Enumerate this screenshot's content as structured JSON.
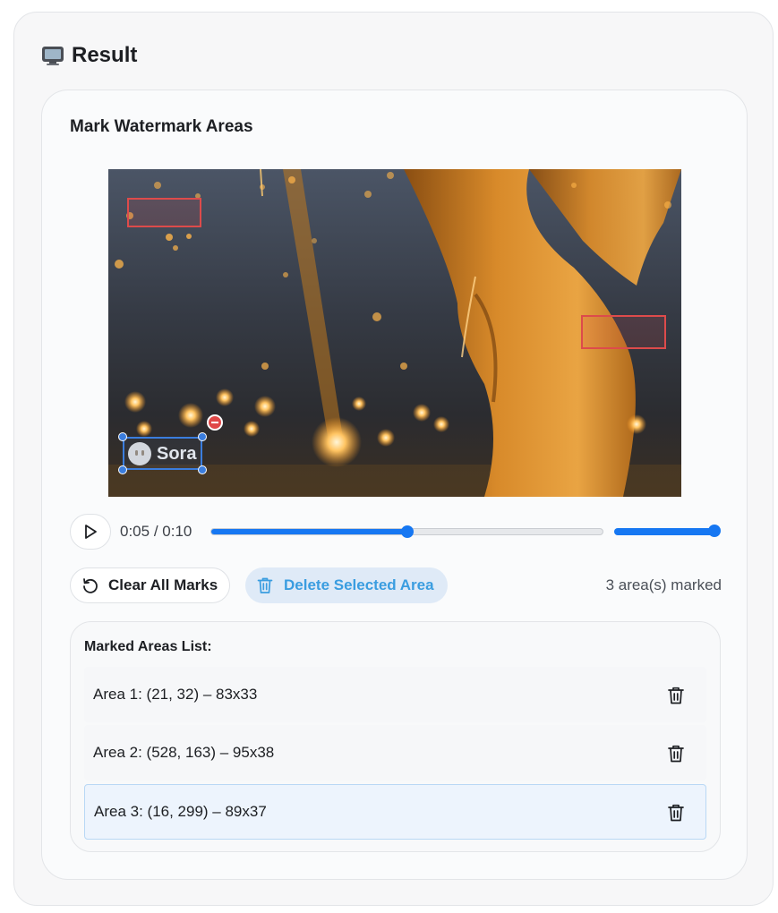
{
  "result": {
    "title": "Result",
    "icon": "tv-icon"
  },
  "panel": {
    "title": "Mark Watermark Areas"
  },
  "video": {
    "watermark_text": "Sora",
    "current_time": "0:05",
    "separator": "/",
    "duration": "0:10",
    "progress": 0.5,
    "volume": 1.0
  },
  "actions": {
    "clear_label": "Clear All Marks",
    "delete_label": "Delete Selected Area",
    "count_text": "3 area(s) marked"
  },
  "list": {
    "title": "Marked Areas List:",
    "items": [
      {
        "label": "Area 1: (21, 32) – 83x33"
      },
      {
        "label": "Area 2: (528, 163) – 95x38"
      },
      {
        "label": "Area 3: (16, 299) – 89x37"
      }
    ]
  },
  "colors": {
    "accent": "#1677f2",
    "mark": "#dd4b4b",
    "selected_mark": "#3b7ddd",
    "delete_text": "#3a9de0"
  }
}
